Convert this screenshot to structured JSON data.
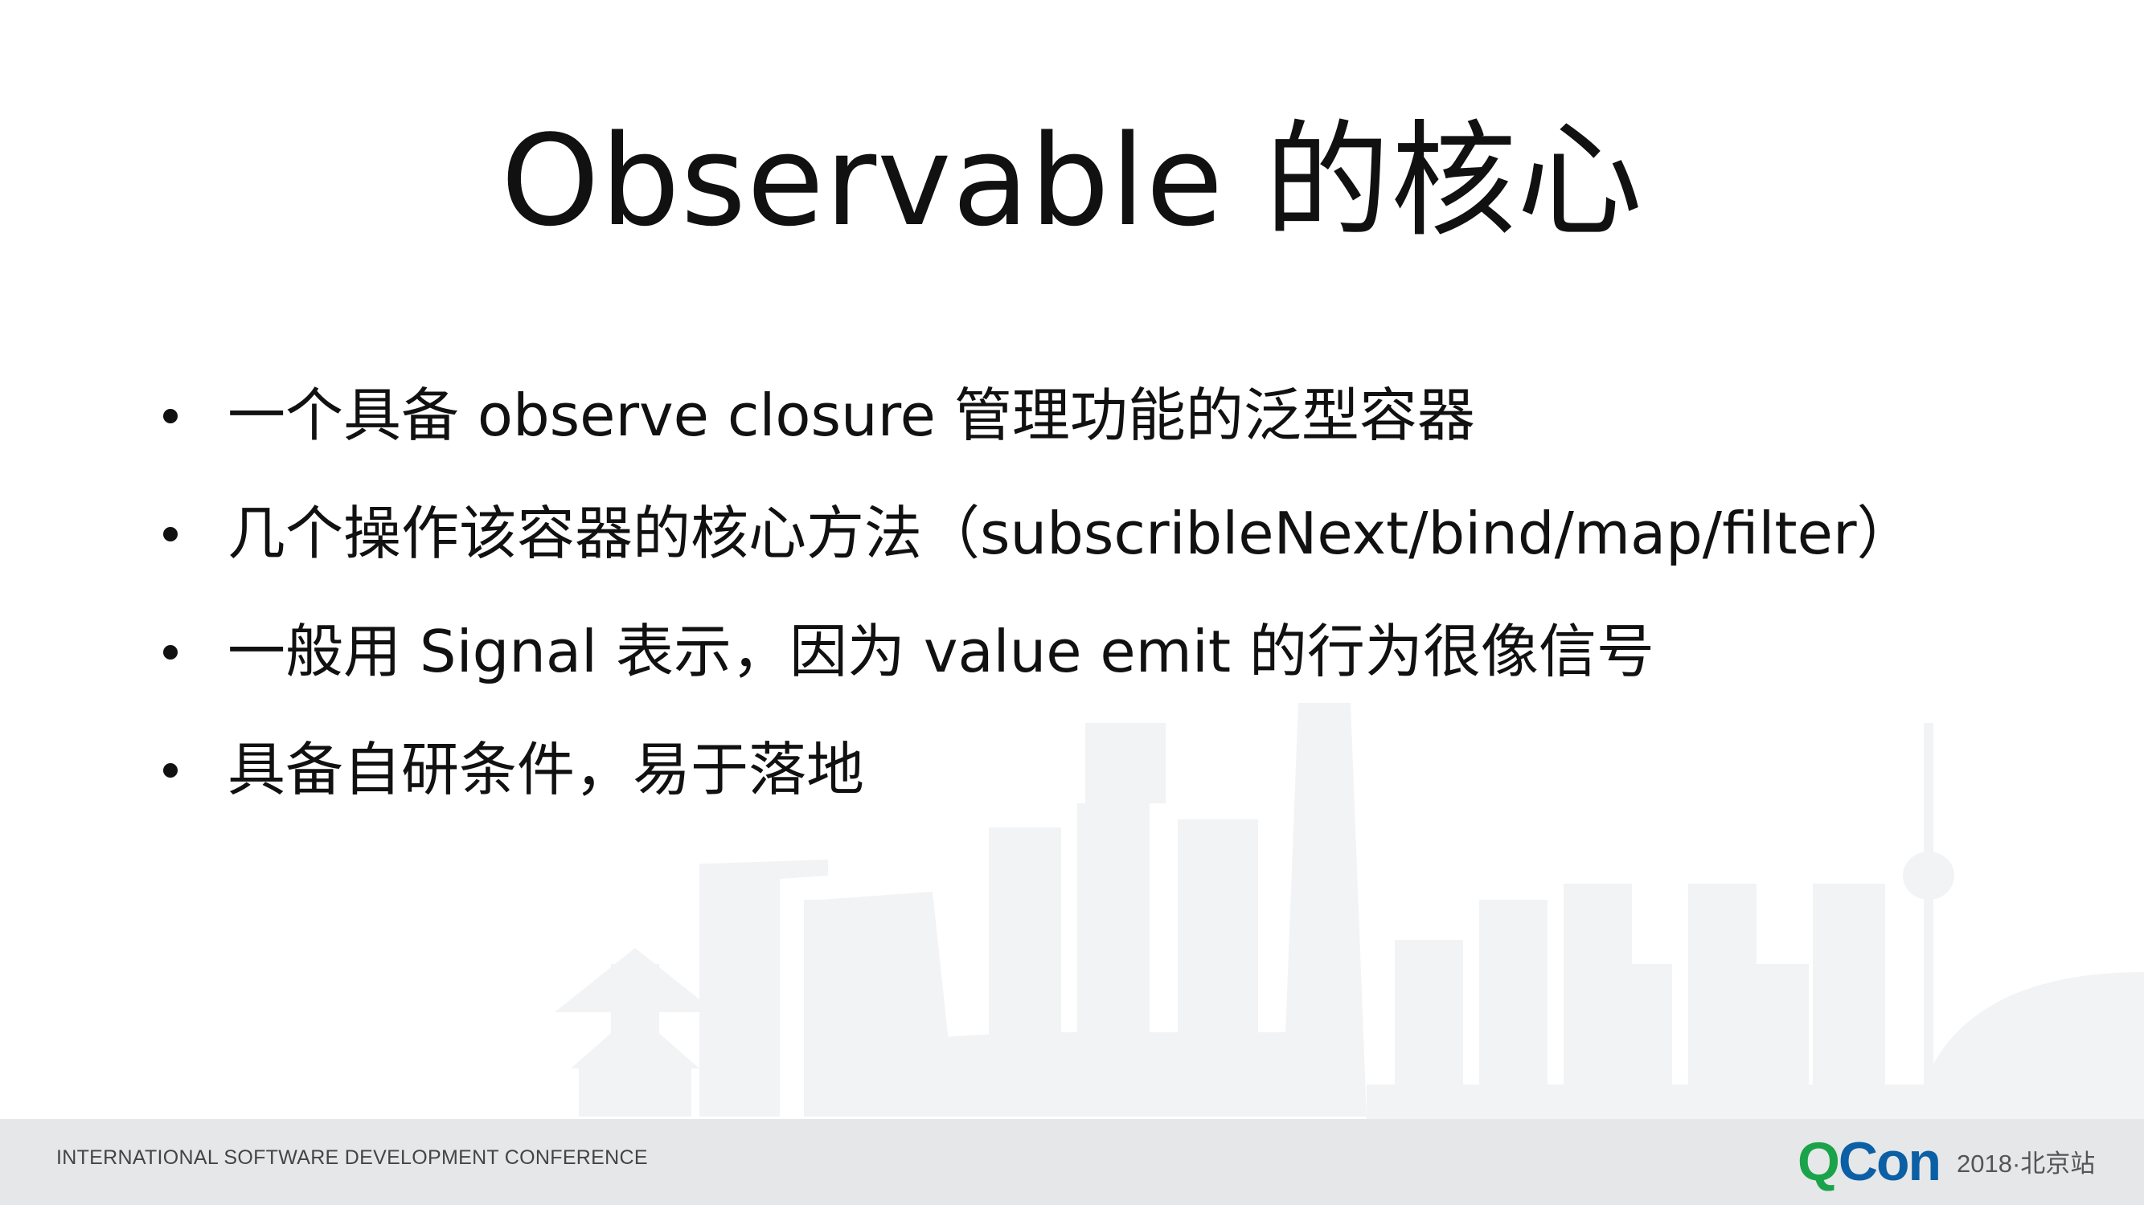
{
  "slide": {
    "title": "Observable 的核心",
    "bullets": [
      "一个具备 observe closure 管理功能的泛型容器",
      "几个操作该容器的核心方法（subscribleNext/bind/map/filter）",
      "一般用 Signal 表示，因为 value emit 的行为很像信号",
      "具备自研条件，易于落地"
    ]
  },
  "footer": {
    "conference_text": "INTERNATIONAL SOFTWARE DEVELOPMENT CONFERENCE",
    "logo_q": "Q",
    "logo_con": "Con",
    "event": "2018·北京站"
  },
  "colors": {
    "text": "#111111",
    "footer_bg": "#e6e7e8",
    "skyline": "#f2f3f5",
    "logo_green": "#1aa34a",
    "logo_blue": "#0b5fa5"
  }
}
